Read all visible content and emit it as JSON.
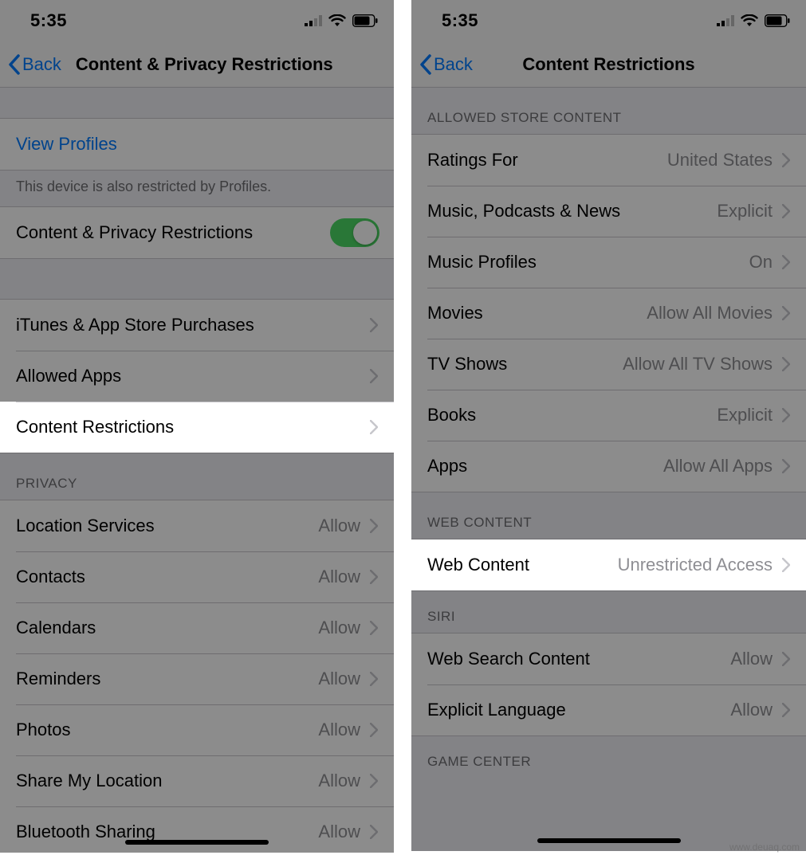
{
  "watermark": "www.deuaq.com",
  "left": {
    "statusbar": {
      "time": "5:35"
    },
    "nav": {
      "back": "Back",
      "title": "Content & Privacy Restrictions"
    },
    "viewProfiles": "View Profiles",
    "profilesFooter": "This device is also restricted by Profiles.",
    "masterToggle": {
      "label": "Content & Privacy Restrictions",
      "on": true
    },
    "rows1": [
      {
        "label": "iTunes & App Store Purchases"
      },
      {
        "label": "Allowed Apps"
      },
      {
        "label": "Content Restrictions"
      }
    ],
    "privacy": {
      "header": "PRIVACY",
      "rows": [
        {
          "label": "Location Services",
          "value": "Allow"
        },
        {
          "label": "Contacts",
          "value": "Allow"
        },
        {
          "label": "Calendars",
          "value": "Allow"
        },
        {
          "label": "Reminders",
          "value": "Allow"
        },
        {
          "label": "Photos",
          "value": "Allow"
        },
        {
          "label": "Share My Location",
          "value": "Allow"
        },
        {
          "label": "Bluetooth Sharing",
          "value": "Allow"
        }
      ]
    }
  },
  "right": {
    "statusbar": {
      "time": "5:35"
    },
    "nav": {
      "back": "Back",
      "title": "Content Restrictions"
    },
    "allowed": {
      "header": "ALLOWED STORE CONTENT",
      "rows": [
        {
          "label": "Ratings For",
          "value": "United States"
        },
        {
          "label": "Music, Podcasts & News",
          "value": "Explicit"
        },
        {
          "label": "Music Profiles",
          "value": "On"
        },
        {
          "label": "Movies",
          "value": "Allow All Movies"
        },
        {
          "label": "TV Shows",
          "value": "Allow All TV Shows"
        },
        {
          "label": "Books",
          "value": "Explicit"
        },
        {
          "label": "Apps",
          "value": "Allow All Apps"
        }
      ]
    },
    "webContent": {
      "header": "WEB CONTENT",
      "rows": [
        {
          "label": "Web Content",
          "value": "Unrestricted Access"
        }
      ]
    },
    "siri": {
      "header": "SIRI",
      "rows": [
        {
          "label": "Web Search Content",
          "value": "Allow"
        },
        {
          "label": "Explicit Language",
          "value": "Allow"
        }
      ]
    },
    "gameCenter": {
      "header": "GAME CENTER"
    }
  }
}
